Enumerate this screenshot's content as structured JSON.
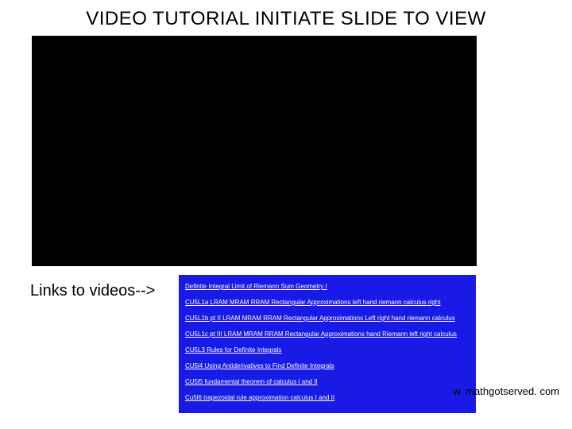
{
  "title": "VIDEO TUTORIAL INITIATE SLIDE TO VIEW",
  "links_label": "Links to videos-->",
  "links": [
    {
      "text": "Definite Integral Limit of Riemann Sum Geometry I"
    },
    {
      "text": "CU5L1a LRAM MRAM RRAM Rectangular Approximations left hand riemann calculus right"
    },
    {
      "text": "CU5L1b pt II LRAM MRAM RRAM Rectangular Approximations Left right hand riemann calculus"
    },
    {
      "text": "CU5L1c pt III LRAM MRAM RRAM Rectangular Approximations hand Riemann left right calculus"
    },
    {
      "text": "CU5L3 Rules for Definite Integrals"
    },
    {
      "text": "CU5l4 Using Antiderivatives to Find Definite Integrals"
    },
    {
      "text": "CU5l5 fundamental theorem of calculus I and II"
    },
    {
      "text": "Cu5l6 trapezoidal rule approximation calculus I and II"
    }
  ],
  "footer_url": "w. mathgotserved. com"
}
